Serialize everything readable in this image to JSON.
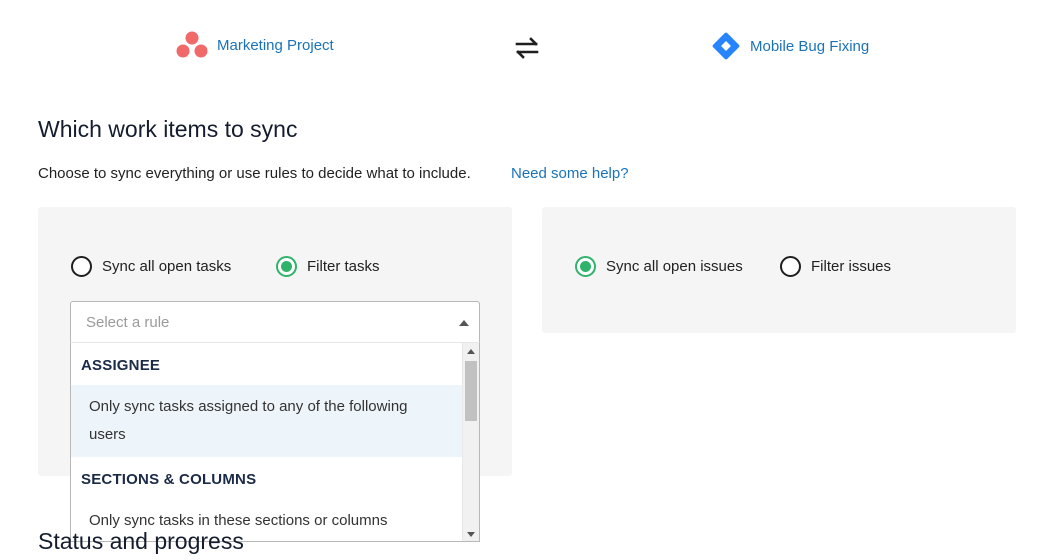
{
  "header": {
    "left_project": {
      "name": "Marketing Project",
      "icon": "asana-dots-icon",
      "color": "#f06a6a"
    },
    "swap_icon": "swap-arrows-icon",
    "right_project": {
      "name": "Mobile Bug Fixing",
      "icon": "jira-diamond-icon",
      "color": "#2684ff"
    }
  },
  "section": {
    "title": "Which work items to sync",
    "subtitle": "Choose to sync everything or use rules to decide what to include.",
    "help_link": "Need some help?"
  },
  "left_panel": {
    "options": [
      {
        "label": "Sync all open tasks",
        "selected": false
      },
      {
        "label": "Filter tasks",
        "selected": true
      }
    ],
    "select": {
      "placeholder": "Select a rule",
      "groups": [
        {
          "header": "ASSIGNEE",
          "options": [
            "Only sync tasks assigned to any of the following users"
          ]
        },
        {
          "header": "SECTIONS & COLUMNS",
          "options": [
            "Only sync tasks in these sections or columns"
          ]
        }
      ]
    }
  },
  "right_panel": {
    "options": [
      {
        "label": "Sync all open issues",
        "selected": true
      },
      {
        "label": "Filter issues",
        "selected": false
      }
    ]
  },
  "next_section": {
    "title": "Status and progress"
  },
  "colors": {
    "accent_green": "#2fb36a",
    "link_blue": "#1a73b8",
    "highlight": "#eef5fa"
  }
}
